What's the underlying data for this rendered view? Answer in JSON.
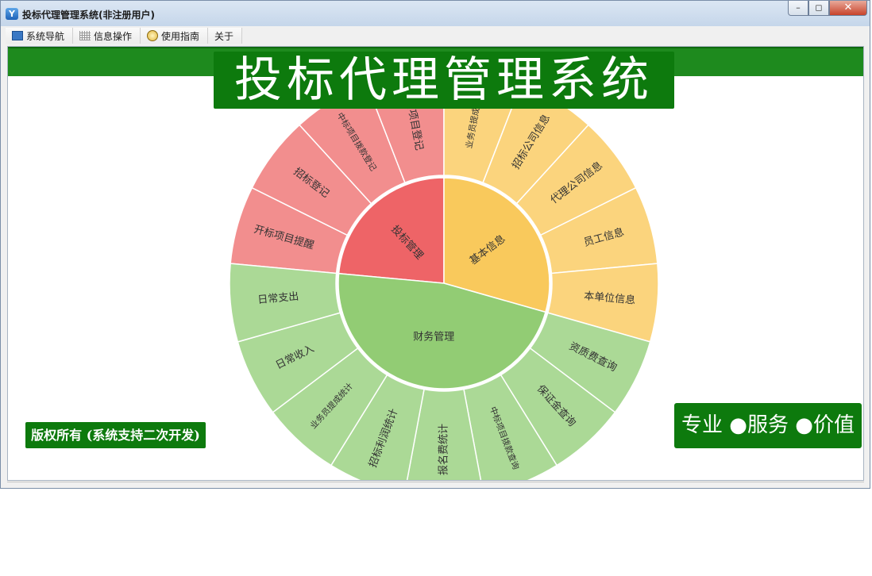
{
  "window": {
    "title": "投标代理管理系统(非注册用户)",
    "app_icon_letter": "Y",
    "controls": {
      "minimize": "–",
      "maximize": "◻",
      "close": "✕"
    }
  },
  "menu": [
    {
      "label": "系统导航",
      "icon": "nav-window-icon"
    },
    {
      "label": "信息操作",
      "icon": "grid-icon"
    },
    {
      "label": "使用指南",
      "icon": "smiley-icon"
    },
    {
      "label": "关于",
      "icon": ""
    }
  ],
  "banner": {
    "title": "投标代理管理系统"
  },
  "footer": {
    "copyright": "版权所有 (系统支持二次开发)",
    "slogan": "专业 ●服务 ●价值"
  },
  "colors": {
    "brand_green": "#0d7a0d",
    "red_inner": "#ee6467",
    "red_outer": "#f28e8e",
    "yellow_inner": "#f9c95c",
    "yellow_outer": "#fbd47d",
    "green_inner": "#92cc74",
    "green_outer": "#abd996"
  },
  "chart_data": {
    "type": "sunburst",
    "groups": [
      {
        "name": "投标管理",
        "color": "red",
        "children": [
          "开标项目提醒",
          "招标登记",
          "中标项目拨款登记",
          "报名项目登记"
        ]
      },
      {
        "name": "基本信息",
        "color": "yellow",
        "children": [
          "业务员提成设置",
          "招标公司信息",
          "代理公司信息",
          "员工信息",
          "本单位信息"
        ]
      },
      {
        "name": "财务管理",
        "color": "green",
        "children": [
          "资质费查询",
          "保证金查询",
          "中标项目拨款查询",
          "报名费统计",
          "招标利润统计",
          "业务员提成统计",
          "日常收入",
          "日常支出"
        ]
      }
    ]
  }
}
